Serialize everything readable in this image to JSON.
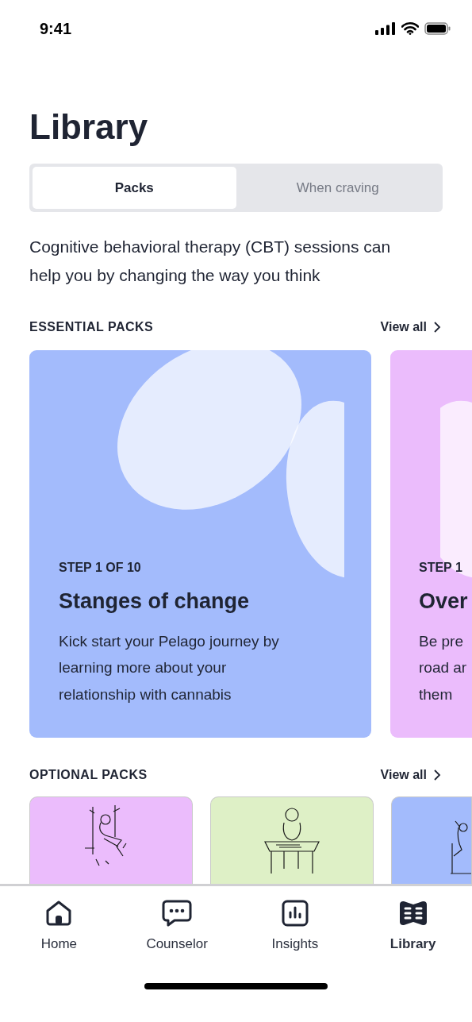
{
  "status_bar": {
    "time": "9:41"
  },
  "title": "Library",
  "tabs": [
    {
      "label": "Packs",
      "selected": true
    },
    {
      "label": "When craving",
      "selected": false
    }
  ],
  "intro": "Cognitive behavioral therapy (CBT) sessions can help you by changing the way you think",
  "essential": {
    "heading": "ESSENTIAL PACKS",
    "view_all": "View all",
    "cards": [
      {
        "step": "STEP 1 OF 10",
        "title": "Stanges of change",
        "lines": [
          "Kick start your Pelago journey by",
          "learning more about your",
          "relationship with cannabis"
        ],
        "color": "#a3bbfc",
        "partial": false
      },
      {
        "step": "STEP 1",
        "title": "Over",
        "lines": [
          "Be pre",
          "road ar",
          "them"
        ],
        "color": "#ebbcfc",
        "partial": true
      }
    ]
  },
  "optional": {
    "heading": "OPTIONAL PACKS",
    "view_all": "View all",
    "cards": [
      {
        "color": "#ebbcfc",
        "kind": "swing"
      },
      {
        "color": "#def0c6",
        "kind": "desk"
      },
      {
        "color": "#a3bbfc",
        "kind": "chair"
      }
    ]
  },
  "nav": [
    {
      "label": "Home",
      "kind": "home",
      "selected": false
    },
    {
      "label": "Counselor",
      "kind": "chat",
      "selected": false
    },
    {
      "label": "Insights",
      "kind": "chart",
      "selected": false
    },
    {
      "label": "Library",
      "kind": "book",
      "selected": true
    }
  ]
}
